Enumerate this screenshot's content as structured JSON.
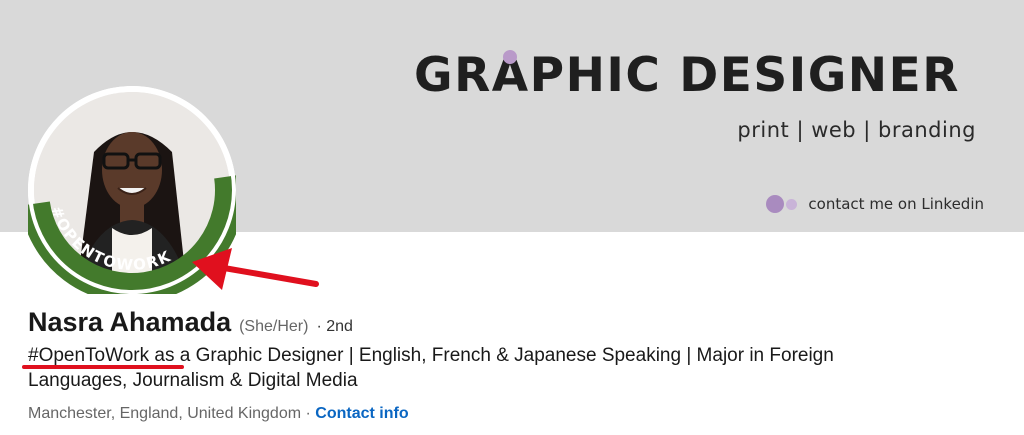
{
  "banner": {
    "title": "GRAPHIC DESIGNER",
    "subtitle": "print | web | branding",
    "contact_text": "contact me on Linkedin"
  },
  "avatar": {
    "badge_text": "#OPENTOWORK",
    "badge_color": "#437a2c"
  },
  "profile": {
    "name": "Nasra Ahamada",
    "pronouns": "(She/Her)",
    "degree": "· 2nd",
    "headline": "#OpenToWork as a Graphic Designer | English, French & Japanese Speaking | Major in Foreign Languages, Journalism & Digital Media",
    "location": "Manchester, England, United Kingdom",
    "separator": "·",
    "contact_info_label": "Contact info"
  },
  "annotation": {
    "color": "#e0101e"
  }
}
